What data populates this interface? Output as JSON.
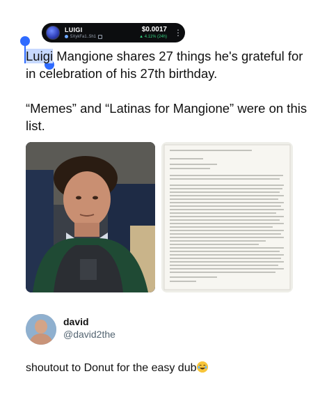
{
  "token": {
    "name": "LUIGI",
    "address": "5XykFa1..5h1",
    "price": "$0.0017",
    "change": "▲ 4.11% (24h)",
    "more_icon": "vertical-dots-icon"
  },
  "post": {
    "highlighted_word": "Luigi",
    "line1_rest": " Mangione shares 27 things he's grateful for in celebration of his 27th birthday.",
    "paragraph2": "“Memes” and “Latinas for Mangione” were on this list."
  },
  "reply": {
    "name": "david",
    "handle": "@david2the",
    "text": "shoutout to Donut for the easy dub",
    "emoji": "face-with-tears-of-joy"
  },
  "colors": {
    "selection": "#2f6bff",
    "highlight": "#c7d9ff",
    "pill_bg": "#0c0d0f",
    "positive": "#35d07f",
    "handle_gray": "#536471"
  }
}
